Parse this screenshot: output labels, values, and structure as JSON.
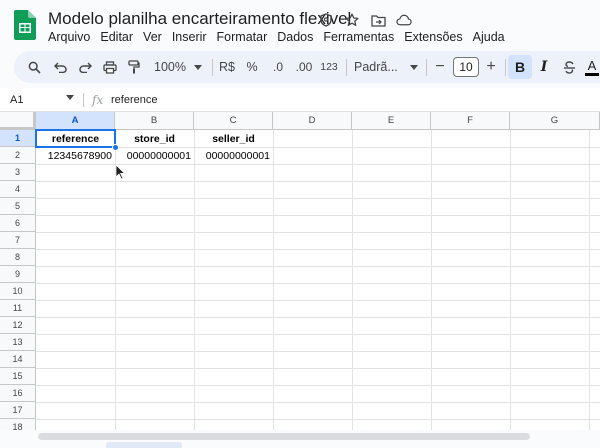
{
  "app": {
    "title": "Modelo planilha encarteiramento flexivel",
    "title_icons": [
      "tag-icon",
      "star-icon",
      "move-to-folder-icon",
      "cloud-saved-icon"
    ],
    "brand_color": "#0f9d58"
  },
  "menu": [
    "Arquivo",
    "Editar",
    "Ver",
    "Inserir",
    "Formatar",
    "Dados",
    "Ferramentas",
    "Extensões",
    "Ajuda"
  ],
  "toolbar": {
    "zoom": "100%",
    "currency": "R$",
    "percent": "%",
    "decrease_decimals": ".0",
    "increase_decimals": ".00",
    "number_format": "123",
    "font": "Padrã...",
    "font_size": "10",
    "bold": "B",
    "italic": "I",
    "text_color": "A",
    "minus": "−",
    "plus": "+"
  },
  "formula_bar": {
    "name_box": "A1",
    "fx": "fx",
    "content": "reference"
  },
  "sheet": {
    "columns": [
      "A",
      "B",
      "C",
      "D",
      "E",
      "F",
      "G"
    ],
    "rows": [
      "1",
      "2",
      "3",
      "4",
      "5",
      "6",
      "7",
      "8",
      "9",
      "10",
      "11",
      "12",
      "13",
      "14",
      "15",
      "16",
      "17",
      "18"
    ],
    "cells": {
      "A1": "reference",
      "B1": "store_id",
      "C1": "seller_id",
      "A2": "12345678900",
      "B2": "00000000001",
      "C2": "00000000001"
    },
    "selected": "A1",
    "selection_color": "#1a73e8"
  }
}
